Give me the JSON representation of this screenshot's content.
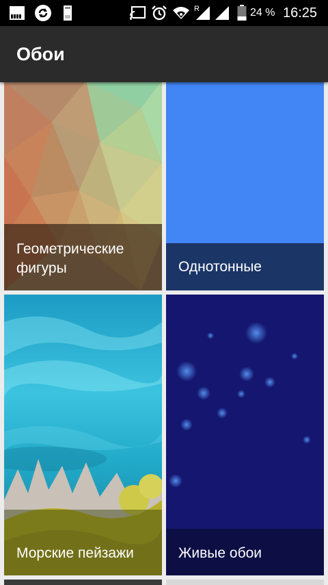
{
  "status_bar": {
    "battery_percent": "24 %",
    "time": "16:25",
    "signal_roaming": "R",
    "icons": [
      "signal-bars-icon",
      "sync-icon",
      "sd-card-icon",
      "cast-icon",
      "alarm-icon",
      "wifi-icon",
      "cell-signal-icon",
      "cell-signal-2-icon",
      "battery-icon"
    ]
  },
  "app_bar": {
    "title": "Обои"
  },
  "tiles": [
    {
      "label": "Геометрические фигуры",
      "icon": "geometric-wallpaper",
      "color": "#5b4433"
    },
    {
      "label": "Однотонные",
      "icon": "solid-color-wallpaper",
      "color": "#4285f4"
    },
    {
      "label": "Морские пейзажи",
      "icon": "seascape-wallpaper",
      "color": "#1fa5c8"
    },
    {
      "label": "Живые обои",
      "icon": "live-wallpaper",
      "color": "#12137a"
    }
  ]
}
